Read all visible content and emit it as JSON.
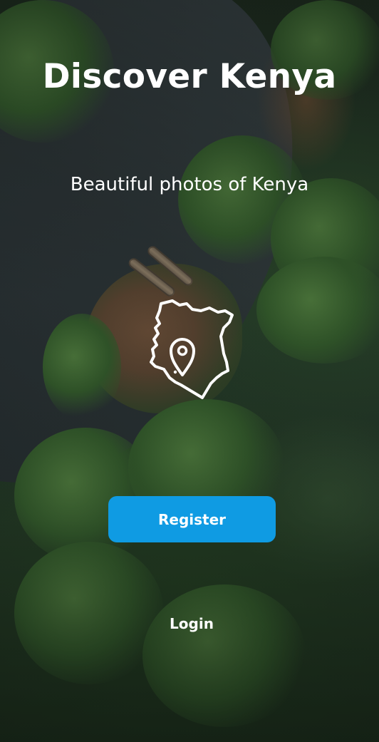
{
  "app": {
    "title": "Discover Kenya",
    "subtitle": "Beautiful photos of Kenya"
  },
  "icons": {
    "logo": "kenya-map-location-pin-icon"
  },
  "actions": {
    "register_label": "Register",
    "login_label": "Login"
  },
  "colors": {
    "primary_button": "#0f9be3",
    "text": "#ffffff"
  }
}
